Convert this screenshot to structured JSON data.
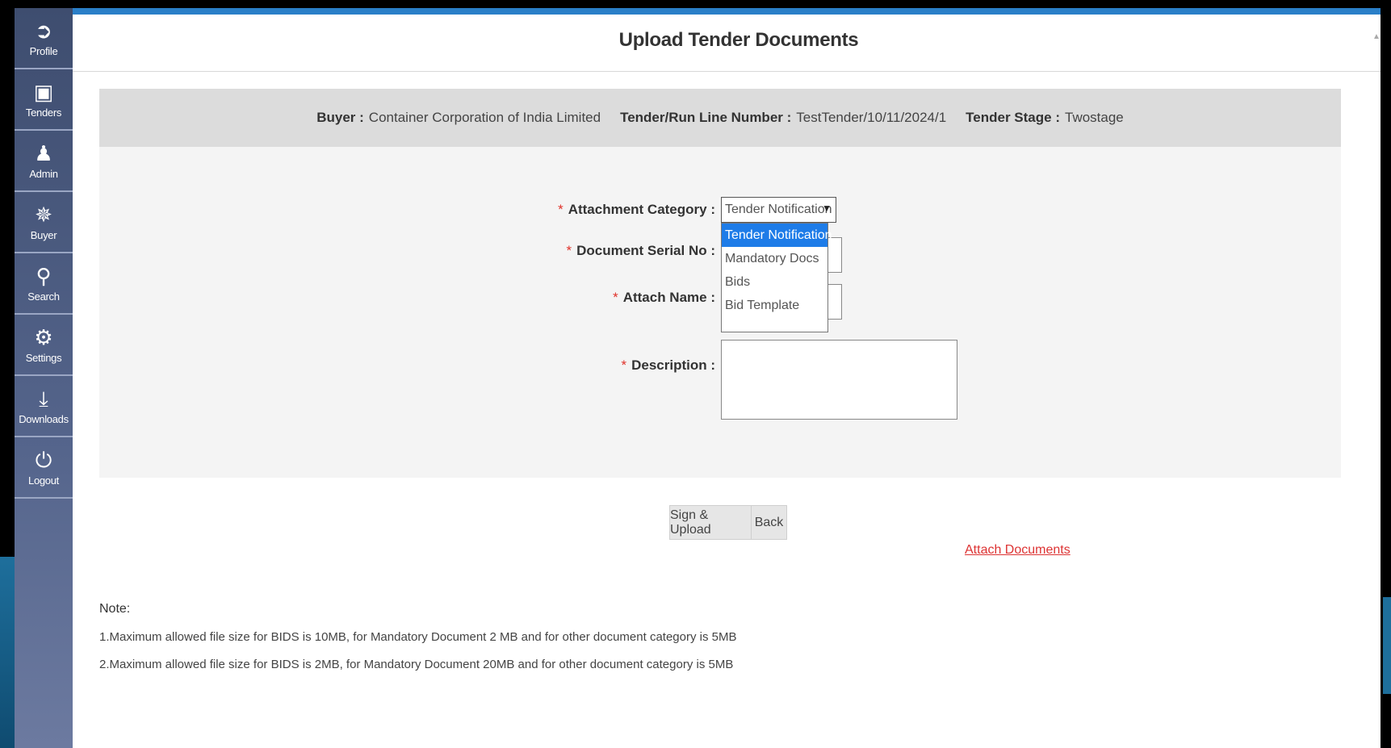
{
  "sidebar": {
    "items": [
      {
        "label": "Profile",
        "icon": "profile-icon",
        "glyph": "➲"
      },
      {
        "label": "Tenders",
        "icon": "tender-icon",
        "glyph": "▣"
      },
      {
        "label": "Admin",
        "icon": "admin-icon",
        "glyph": "♟"
      },
      {
        "label": "Buyer",
        "icon": "buyer-icon",
        "glyph": "✵"
      },
      {
        "label": "Search",
        "icon": "search-icon",
        "glyph": "⚲"
      },
      {
        "label": "Settings",
        "icon": "gear-icon",
        "glyph": "⚙"
      },
      {
        "label": "Downloads",
        "icon": "download-icon",
        "glyph": "⤓"
      },
      {
        "label": "Logout",
        "icon": "power-icon",
        "glyph": "⏻"
      }
    ]
  },
  "page": {
    "title": "Upload Tender Documents"
  },
  "info": {
    "buyer_label": "Buyer :",
    "buyer_value": "Container Corporation of India Limited",
    "tender_label": "Tender/Run Line Number :",
    "tender_value": "TestTender/10/11/2024/1",
    "stage_label": "Tender Stage :",
    "stage_value": "Twostage"
  },
  "form": {
    "attachment_category_label": "Attachment Category :",
    "attachment_category_value": "Tender Notification",
    "document_serial_label": "Document Serial No :",
    "attach_name_label": "Attach Name :",
    "description_label": "Description :",
    "dropdown_options": [
      "Tender Notification",
      "Mandatory Docs",
      "Bids",
      "Bid Template"
    ]
  },
  "buttons": {
    "sign_upload": "Sign & Upload",
    "back": "Back"
  },
  "links": {
    "attach_documents": "Attach Documents"
  },
  "notes": {
    "title": "Note:",
    "line1": "1.Maximum allowed file size for BIDS is 10MB, for Mandatory Document 2 MB and for other document category is 5MB",
    "line2": "2.Maximum allowed file size for BIDS is 2MB, for Mandatory Document 20MB and for other document category is 5MB"
  },
  "colors": {
    "sidebar": "#4a5a7f",
    "accent": "#1e7ce8",
    "required": "#e0322a",
    "link": "#d33333"
  }
}
